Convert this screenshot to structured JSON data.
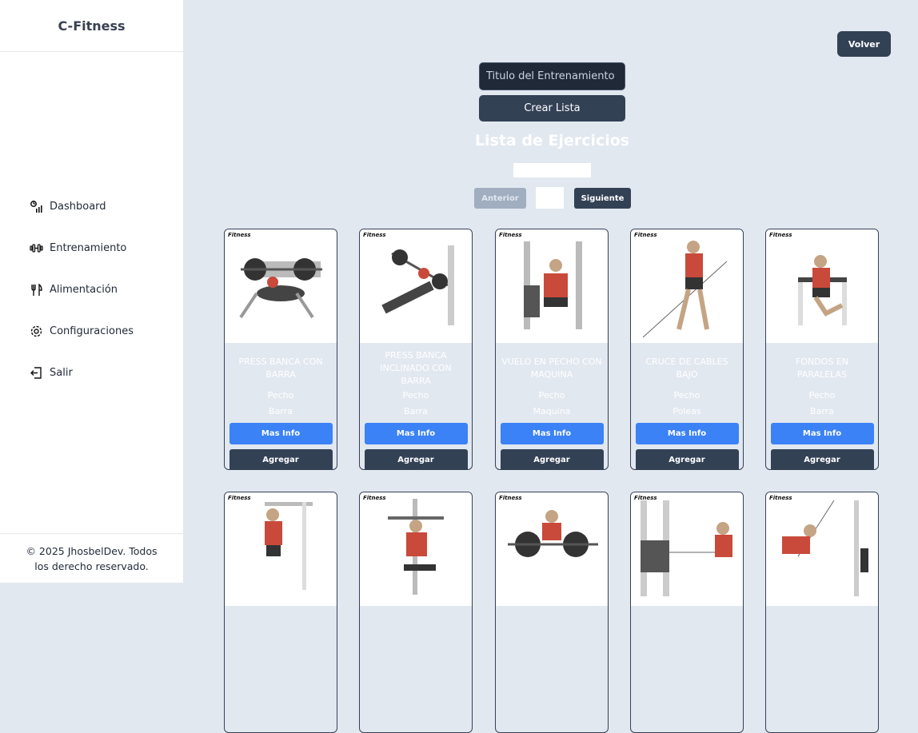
{
  "app": {
    "brand": "C-Fitness"
  },
  "sidebar": {
    "items": [
      {
        "label": "Dashboard",
        "icon": "dashboard-icon"
      },
      {
        "label": "Entrenamiento",
        "icon": "dumbbell-icon"
      },
      {
        "label": "Alimentación",
        "icon": "fork-knife-icon"
      },
      {
        "label": "Configuraciones",
        "icon": "gear-icon"
      },
      {
        "label": "Salir",
        "icon": "logout-icon"
      }
    ],
    "footer": "© 2025 JhosbelDev. Todos los derecho reservado."
  },
  "header": {
    "back_label": "Volver"
  },
  "form": {
    "title_placeholder": "Titulo del Entrenamiento",
    "create_label": "Crear Lista"
  },
  "exercises": {
    "title": "Lista de Ejercicios",
    "prev_label": "Anterior",
    "next_label": "Siguiente",
    "logo_text": "Fitness",
    "cards": [
      {
        "name": "PRESS BANCA CON BARRA",
        "muscle": "Pecho",
        "equipment": "Barra",
        "info_label": "Mas Info",
        "add_label": "Agregar"
      },
      {
        "name": "PRESS BANCA INCLINADO CON BARRA",
        "muscle": "Pecho",
        "equipment": "Barra",
        "info_label": "Mas Info",
        "add_label": "Agregar"
      },
      {
        "name": "VUELO EN PECHO CON MAQUINA",
        "muscle": "Pecho",
        "equipment": "Maquina",
        "info_label": "Mas Info",
        "add_label": "Agregar"
      },
      {
        "name": "CRUCE DE CABLES BAJO",
        "muscle": "Pecho",
        "equipment": "Poleas",
        "info_label": "Mas Info",
        "add_label": "Agregar"
      },
      {
        "name": "FONDOS EN PARALELAS",
        "muscle": "Pecho",
        "equipment": "Barra",
        "info_label": "Mas Info",
        "add_label": "Agregar"
      }
    ]
  }
}
